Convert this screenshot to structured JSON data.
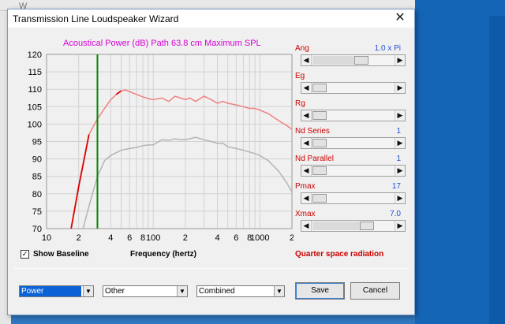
{
  "window": {
    "title": "Transmission Line Loudspeaker Wizard",
    "close_glyph": "✕"
  },
  "chart_data": {
    "type": "line",
    "title": "Acoustical Power (dB)   Path 63.8 cm    Maximum SPL",
    "xlabel": "Frequency (hertz)",
    "x_scale": "log",
    "xlim": [
      10,
      2000
    ],
    "ylim": [
      70,
      120
    ],
    "y_ticks": [
      70,
      75,
      80,
      85,
      90,
      95,
      100,
      105,
      110,
      115,
      120
    ],
    "x_tick_labels": [
      "10",
      "2",
      "4",
      "6",
      "8",
      "100",
      "2",
      "4",
      "6",
      "8",
      "1000",
      "2"
    ],
    "marker_frequency": 30,
    "grid": true,
    "series": [
      {
        "color": "#f08080",
        "highlight_color": "#dd0000",
        "x": [
          17,
          20,
          25,
          30,
          35,
          40,
          45,
          50,
          55,
          60,
          70,
          80,
          90,
          100,
          120,
          140,
          160,
          180,
          200,
          220,
          250,
          300,
          350,
          400,
          450,
          500,
          600,
          700,
          800,
          900,
          1000,
          1200,
          1500,
          1800,
          2000
        ],
        "y": [
          70,
          82,
          97,
          101.5,
          104.5,
          107,
          108.5,
          109.5,
          109.8,
          109.3,
          108.5,
          107.8,
          107.3,
          107,
          107.5,
          106.5,
          108,
          107.5,
          107,
          107.5,
          106.5,
          108,
          107,
          106,
          106.5,
          106,
          105.5,
          105,
          104.5,
          104.5,
          104,
          103,
          101,
          99.5,
          98.5
        ]
      },
      {
        "color": "#b4b4b4",
        "x": [
          22,
          25,
          30,
          35,
          40,
          50,
          60,
          70,
          80,
          90,
          100,
          120,
          140,
          160,
          180,
          200,
          220,
          250,
          300,
          350,
          400,
          450,
          500,
          600,
          700,
          800,
          900,
          1000,
          1200,
          1500,
          1800,
          2000
        ],
        "y": [
          70,
          76.5,
          85,
          89.5,
          91,
          92.5,
          93,
          93.3,
          93.8,
          94,
          94,
          95.5,
          95.3,
          95.8,
          95.5,
          95.5,
          95.8,
          96.2,
          95.5,
          95,
          94.5,
          94.5,
          93.5,
          93,
          92.5,
          92,
          91.5,
          91,
          89.5,
          86.5,
          83,
          80.5
        ]
      }
    ]
  },
  "controls": [
    {
      "label": "Ang",
      "value": "1.0 x Pi",
      "position": 0.62
    },
    {
      "label": "Eg",
      "value": "",
      "position": 0.0
    },
    {
      "label": "Rg",
      "value": "",
      "position": 0.0
    },
    {
      "label": "Nd  Series",
      "value": "1",
      "position": 0.0
    },
    {
      "label": "Nd  Parallel",
      "value": "1",
      "position": 0.0
    },
    {
      "label": "Pmax",
      "value": "17",
      "position": 0.0
    },
    {
      "label": "Xmax",
      "value": "7.0",
      "position": 0.7
    }
  ],
  "baseline": {
    "label": "Show Baseline",
    "checked": true,
    "check_glyph": "✓"
  },
  "radiation": "Quarter space radiation",
  "selects": {
    "power": "Power",
    "other": "Other",
    "combined": "Combined",
    "arrow": "▼"
  },
  "buttons": {
    "save": "Save",
    "cancel": "Cancel"
  },
  "arrows": {
    "left": "◀",
    "right": "▶"
  },
  "background": {
    "title": "W"
  }
}
